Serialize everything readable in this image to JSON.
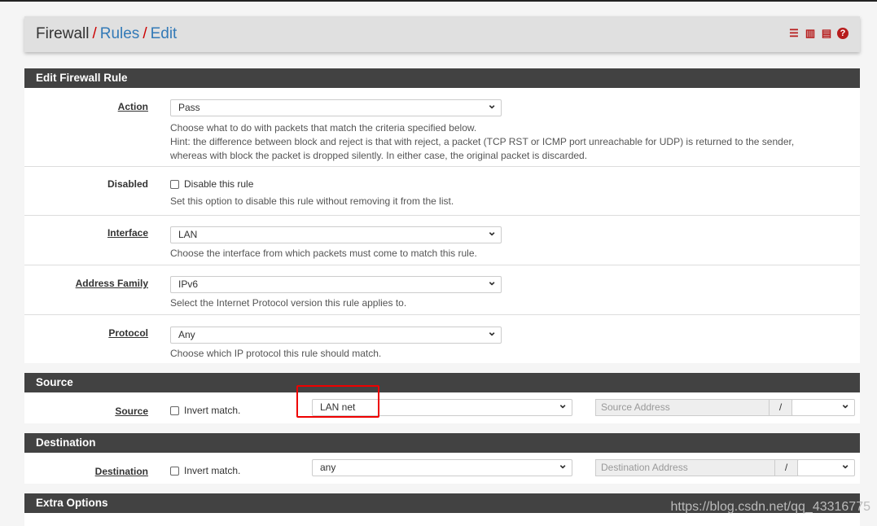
{
  "breadcrumb": {
    "root": "Firewall",
    "sep": "/",
    "rules": "Rules",
    "edit": "Edit"
  },
  "header_icons": [
    "sliders-icon",
    "bar-chart-icon",
    "table-list-icon",
    "help-icon"
  ],
  "edit_rule": {
    "title": "Edit Firewall Rule",
    "action": {
      "label": "Action",
      "value": "Pass",
      "help1": "Choose what to do with packets that match the criteria specified below.",
      "help2": "Hint: the difference between block and reject is that with reject, a packet (TCP RST or ICMP port unreachable for UDP) is returned to the sender,",
      "help3": "whereas with block the packet is dropped silently. In either case, the original packet is discarded."
    },
    "disabled": {
      "label": "Disabled",
      "checkbox": "Disable this rule",
      "help": "Set this option to disable this rule without removing it from the list."
    },
    "interface": {
      "label": "Interface",
      "value": "LAN",
      "help": "Choose the interface from which packets must come to match this rule."
    },
    "address_family": {
      "label": "Address Family",
      "value": "IPv6",
      "help": "Select the Internet Protocol version this rule applies to."
    },
    "protocol": {
      "label": "Protocol",
      "value": "Any",
      "help": "Choose which IP protocol this rule should match."
    }
  },
  "source": {
    "title": "Source",
    "label": "Source",
    "invert": "Invert match.",
    "value": "LAN net",
    "address_placeholder": "Source Address",
    "slash": "/"
  },
  "destination": {
    "title": "Destination",
    "label": "Destination",
    "invert": "Invert match.",
    "value": "any",
    "address_placeholder": "Destination Address",
    "slash": "/"
  },
  "extra": {
    "title": "Extra Options"
  },
  "watermark": "https://blog.csdn.net/qq_43316775",
  "colors": {
    "header": "#424242",
    "link": "#337ab7",
    "icon": "#b71c1c",
    "highlight": "#ee0000"
  }
}
